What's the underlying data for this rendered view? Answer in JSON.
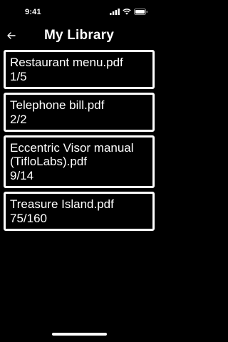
{
  "status_bar": {
    "time": "9:41",
    "icons": [
      "signal-icon",
      "wifi-icon",
      "battery-icon"
    ]
  },
  "header": {
    "back_icon": "arrow-left-icon",
    "title": "My Library"
  },
  "documents": [
    {
      "name": "Restaurant menu.pdf",
      "progress": "1/5"
    },
    {
      "name": "Telephone bill.pdf",
      "progress": "2/2"
    },
    {
      "name": "Eccentric Visor manual (TifloLabs).pdf",
      "progress": "9/14"
    },
    {
      "name": "Treasure Island.pdf",
      "progress": "75/160"
    }
  ],
  "colors": {
    "background": "#000000",
    "foreground": "#ffffff"
  }
}
